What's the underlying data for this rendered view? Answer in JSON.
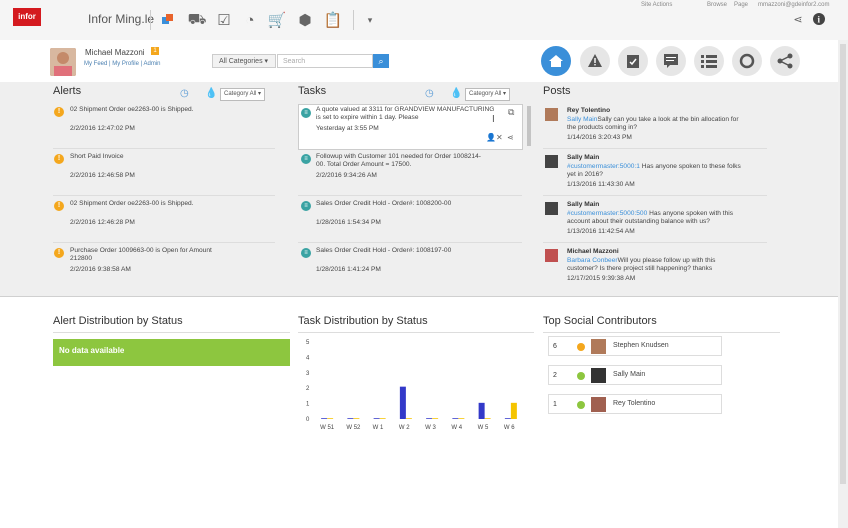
{
  "header": {
    "logo": "infor",
    "app_name": "Infor Ming.le",
    "links": [
      "Site Actions",
      "Browse",
      "Page"
    ],
    "email": "mmazzoni@gdeinfor2.com"
  },
  "user": {
    "name": "Michael Mazzoni",
    "badge": "1",
    "links": [
      "My Feed",
      "My Profile",
      "Admin"
    ]
  },
  "search": {
    "category": "All Categories",
    "placeholder": "Search"
  },
  "alerts": {
    "title": "Alerts",
    "filter": "Category All",
    "items": [
      {
        "text": "02 Shipment Order oe2263-00 is Shipped.",
        "date": "2/2/2016 12:47:02 PM"
      },
      {
        "text": "Short Paid Invoice",
        "date": "2/2/2016 12:46:58 PM"
      },
      {
        "text": "02 Shipment Order oe2263-00 is Shipped.",
        "date": "2/2/2016 12:46:28 PM"
      },
      {
        "text": "Purchase Order 1009663-00 is Open for Amount 212800",
        "date": "2/2/2016 9:38:58 AM"
      }
    ]
  },
  "tasks": {
    "title": "Tasks",
    "filter": "Category All",
    "items": [
      {
        "text": "A quote valued at 3311 for GRANDVIEW MANUFACTURING is set to expire within 1 day. Please",
        "date": "Yesterday at 3:55 PM"
      },
      {
        "text": "Followup with Customer 101 needed for Order 1008214-00. Total Order Amount = 17500.",
        "date": "2/2/2016 9:34:26 AM"
      },
      {
        "text": "Sales Order Credit Hold - Order#: 1008200-00",
        "date": "1/28/2016 1:54:34 PM"
      },
      {
        "text": "Sales Order Credit Hold - Order#: 1008197-00",
        "date": "1/28/2016 1:41:24 PM"
      }
    ]
  },
  "posts": {
    "title": "Posts",
    "items": [
      {
        "author": "Rey Tolentino",
        "mention": "Sally Main",
        "text": "Sally can you take a look at the bin allocation for the products coming in?",
        "date": "1/14/2016 3:20:43 PM"
      },
      {
        "author": "Sally Main",
        "mention": "#customermaster:5000:1",
        "text": " Has anyone  spoken to these folks yet in 2016?",
        "date": "1/13/2016 11:43:30 AM"
      },
      {
        "author": "Sally Main",
        "mention": "#customermaster:5000:500",
        "text": " Has anyone spoken with this account about their outstanding balance with us?",
        "date": "1/13/2016 11:42:54 AM"
      },
      {
        "author": "Michael Mazzoni",
        "mention": "Barbara Conbeer",
        "text": "Will you please follow up with this customer?  Is there project still happening? thanks",
        "date": "12/17/2015 9:39:38 AM"
      }
    ]
  },
  "alert_distribution": {
    "title": "Alert Distribution by Status",
    "empty_message": "No data available"
  },
  "task_distribution": {
    "title": "Task Distribution by Status"
  },
  "chart_data": {
    "type": "bar",
    "categories": [
      "W 51",
      "W 52",
      "W 1",
      "W 2",
      "W 3",
      "W 4",
      "W 5",
      "W 6"
    ],
    "series": [
      {
        "values": [
          0.05,
          0.05,
          0.05,
          2.1,
          0.05,
          0.05,
          1.05,
          0.05
        ],
        "color": "#3339c9"
      },
      {
        "values": [
          0.05,
          0.05,
          0.05,
          0.05,
          0.05,
          0.05,
          0.05,
          1.05
        ],
        "color": "#f5c400"
      }
    ],
    "yticks": [
      "5",
      "4",
      "3",
      "2",
      "1",
      "0"
    ],
    "ylim": [
      0,
      5
    ]
  },
  "contributors": {
    "title": "Top Social Contributors",
    "items": [
      {
        "rank": "6",
        "name": "Stephen Knudsen",
        "color": "#f4a71d"
      },
      {
        "rank": "2",
        "name": "Sally Main",
        "color": "#8dc63f"
      },
      {
        "rank": "1",
        "name": "Rey Tolentino",
        "color": "#8dc63f"
      }
    ]
  }
}
